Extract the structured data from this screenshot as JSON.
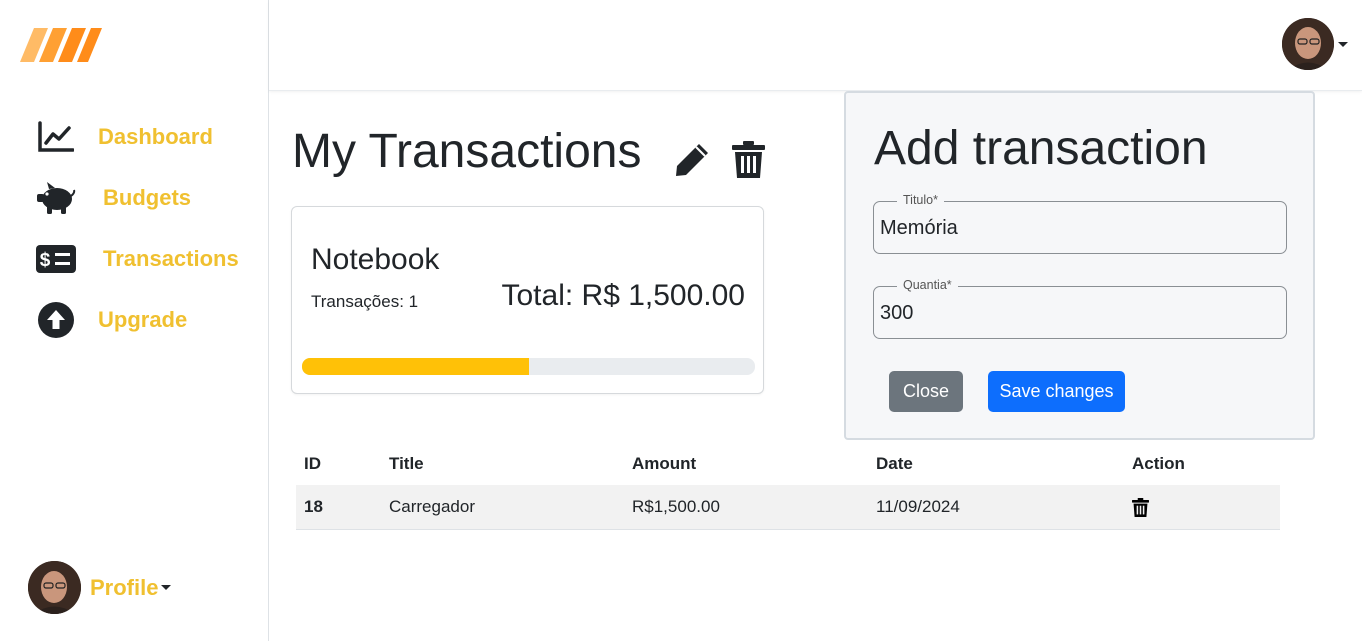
{
  "colors": {
    "accent": "#f0c030",
    "logo": "#ff8c1a",
    "progress": "#ffc107",
    "primary": "#0d6efd",
    "secondary": "#6c757d"
  },
  "sidebar": {
    "logo_icon": "stripes-logo",
    "items": [
      {
        "label": "Dashboard",
        "icon": "line-chart-icon"
      },
      {
        "label": "Budgets",
        "icon": "piggy-bank-icon"
      },
      {
        "label": "Transactions",
        "icon": "money-bill-icon"
      },
      {
        "label": "Upgrade",
        "icon": "arrow-up-circle-icon"
      }
    ],
    "profile_label": "Profile"
  },
  "main": {
    "title": "My Transactions",
    "card": {
      "name": "Notebook",
      "count_text": "Transações: 1",
      "total_text": "Total: R$ 1,500.00",
      "progress_fraction": 0.5
    },
    "table": {
      "headers": [
        "ID",
        "Title",
        "Amount",
        "Date",
        "Action"
      ],
      "rows": [
        {
          "id": "18",
          "title": "Carregador",
          "amount": "R$1,500.00",
          "date": "11/09/2024"
        }
      ]
    }
  },
  "modal": {
    "title": "Add transaction",
    "title_field": {
      "label": "Titulo",
      "required_mark": "*",
      "value": "Memória"
    },
    "amount_field": {
      "label": "Quantia",
      "required_mark": "*",
      "value": "300"
    },
    "close_label": "Close",
    "save_label": "Save changes"
  }
}
